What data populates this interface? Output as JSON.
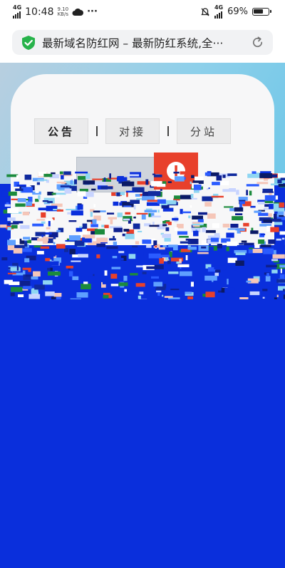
{
  "status_bar": {
    "network_left": "4G",
    "time": "10:48",
    "speed": "9.10",
    "speed_unit": "KB/s",
    "more_indicator": "···",
    "network_right": "4G",
    "battery_level": "69%",
    "battery_fraction": 0.69
  },
  "browser": {
    "page_title": "最新域名防红网 – 最新防红系统,全···",
    "security_icon": "shield-check-icon",
    "reload_icon": "reload-icon"
  },
  "page": {
    "tabs": [
      {
        "label": "公告",
        "active": true
      },
      {
        "label": "对接",
        "active": false
      },
      {
        "label": "分站",
        "active": false
      }
    ],
    "alert_symbol": "!",
    "alert_icon": "exclamation-icon"
  },
  "colors": {
    "page_background": "#0a2fdc",
    "shield_green": "#27b34b",
    "alert_red": "#e8402b"
  }
}
